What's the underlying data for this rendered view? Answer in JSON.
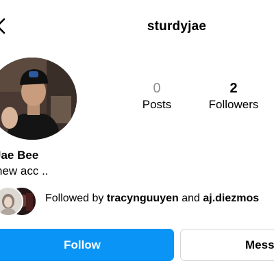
{
  "header": {
    "username": "sturdyjae",
    "back_icon": "back-chevron-icon"
  },
  "profile": {
    "display_name": "Jae Bee",
    "bio": "new acc ..",
    "avatar_icon": "profile-photo"
  },
  "stats": {
    "posts": {
      "count": "0",
      "label": "Posts"
    },
    "followers": {
      "count": "2",
      "label": "Followers"
    }
  },
  "followed_by": {
    "prefix": "Followed by ",
    "user1": "tracynguuyen",
    "joiner": " and ",
    "user2": "aj.diezmos"
  },
  "actions": {
    "follow_label": "Follow",
    "message_label": "Message"
  },
  "colors": {
    "follow_button": "#0a95f6",
    "muted_count": "#8e8e8e"
  }
}
